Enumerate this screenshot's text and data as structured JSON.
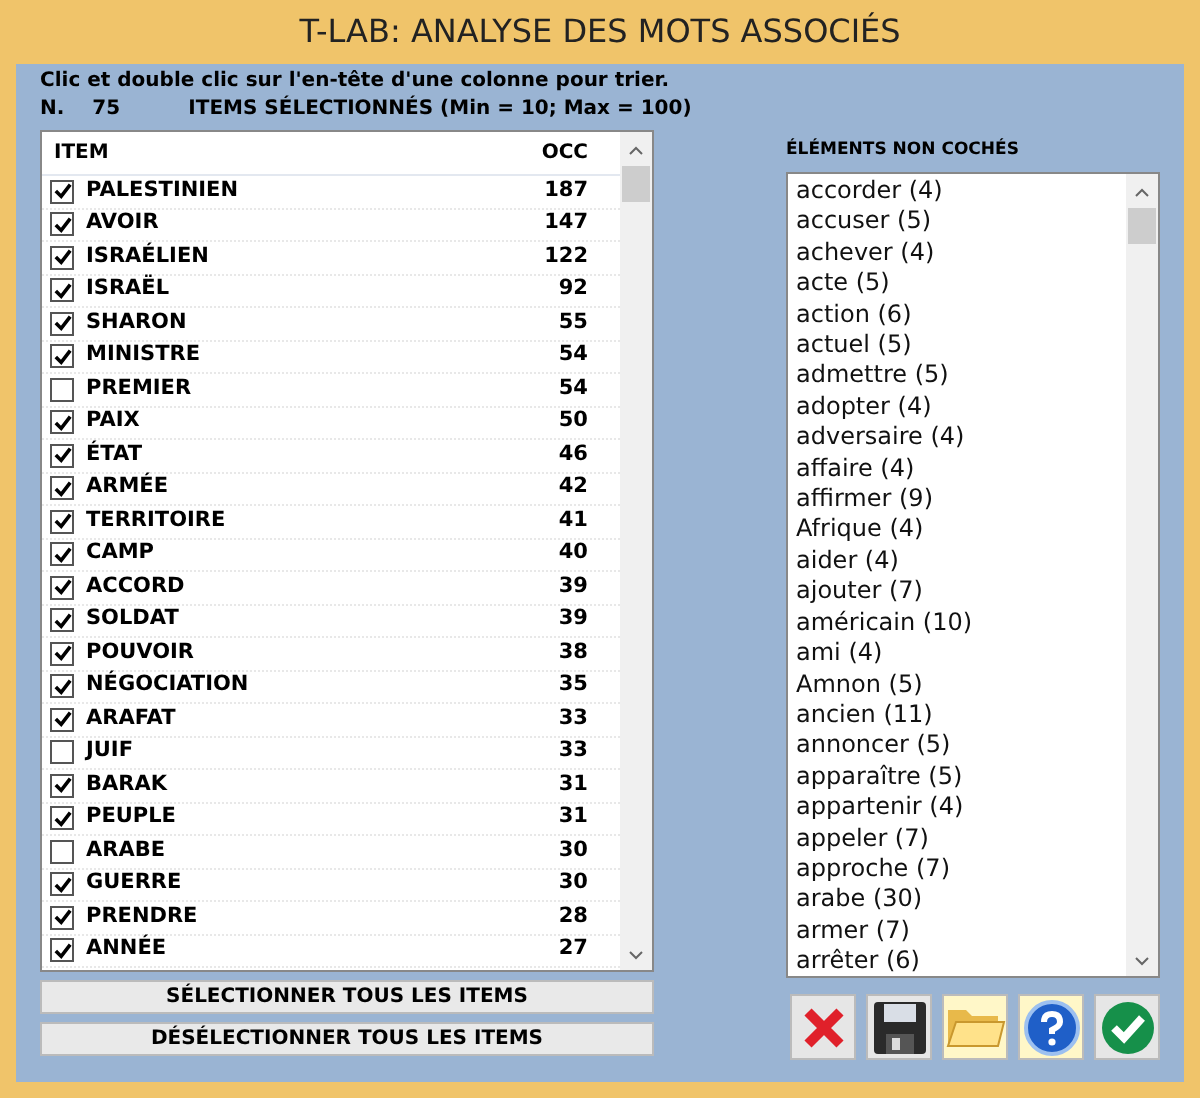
{
  "window": {
    "title": "T-LAB: ANALYSE DES MOTS ASSOCIÉS"
  },
  "hint": "Clic et double clic sur l'en-tête d'une colonne pour trier.",
  "count": {
    "label": "N.",
    "value": "75",
    "caption": "ITEMS SÉLECTIONNÉS (Min = 10; Max = 100)"
  },
  "table": {
    "columns": [
      "ITEM",
      "OCC"
    ],
    "rows": [
      {
        "item": "PALESTINIEN",
        "occ": "187",
        "checked": true
      },
      {
        "item": "AVOIR",
        "occ": "147",
        "checked": true
      },
      {
        "item": "ISRAÉLIEN",
        "occ": "122",
        "checked": true
      },
      {
        "item": "ISRAËL",
        "occ": "92",
        "checked": true
      },
      {
        "item": "SHARON",
        "occ": "55",
        "checked": true
      },
      {
        "item": "MINISTRE",
        "occ": "54",
        "checked": true
      },
      {
        "item": "PREMIER",
        "occ": "54",
        "checked": false
      },
      {
        "item": "PAIX",
        "occ": "50",
        "checked": true
      },
      {
        "item": "ÉTAT",
        "occ": "46",
        "checked": true
      },
      {
        "item": "ARMÉE",
        "occ": "42",
        "checked": true
      },
      {
        "item": "TERRITOIRE",
        "occ": "41",
        "checked": true
      },
      {
        "item": "CAMP",
        "occ": "40",
        "checked": true
      },
      {
        "item": "ACCORD",
        "occ": "39",
        "checked": true
      },
      {
        "item": "SOLDAT",
        "occ": "39",
        "checked": true
      },
      {
        "item": "POUVOIR",
        "occ": "38",
        "checked": true
      },
      {
        "item": "NÉGOCIATION",
        "occ": "35",
        "checked": true
      },
      {
        "item": "ARAFAT",
        "occ": "33",
        "checked": true
      },
      {
        "item": "JUIF",
        "occ": "33",
        "checked": false
      },
      {
        "item": "BARAK",
        "occ": "31",
        "checked": true
      },
      {
        "item": "PEUPLE",
        "occ": "31",
        "checked": true
      },
      {
        "item": "ARABE",
        "occ": "30",
        "checked": false
      },
      {
        "item": "GUERRE",
        "occ": "30",
        "checked": true
      },
      {
        "item": "PRENDRE",
        "occ": "28",
        "checked": true
      },
      {
        "item": "ANNÉE",
        "occ": "27",
        "checked": true
      }
    ]
  },
  "buttons": [
    "SÉLECTIONNER TOUS LES ITEMS",
    "DÉSÉLECTIONNER TOUS LES ITEMS"
  ],
  "unchecked": {
    "title": "ÉLÉMENTS NON COCHÉS",
    "items": [
      "accorder (4)",
      "accuser (5)",
      "achever (4)",
      "acte (5)",
      "action (6)",
      "actuel (5)",
      "admettre (5)",
      "adopter (4)",
      "adversaire (4)",
      "affaire (4)",
      "affirmer (9)",
      "Afrique (4)",
      "aider (4)",
      "ajouter (7)",
      "américain (10)",
      "ami (4)",
      "Amnon (5)",
      "ancien (11)",
      "annoncer (5)",
      "apparaître (5)",
      "appartenir (4)",
      "appeler (7)",
      "approche (7)",
      "arabe (30)",
      "armer (7)",
      "arrêter (6)"
    ]
  },
  "toolbar": [
    {
      "kind": "cancel"
    },
    {
      "kind": "save"
    },
    {
      "kind": "open"
    },
    {
      "kind": "help"
    },
    {
      "kind": "ok"
    }
  ]
}
